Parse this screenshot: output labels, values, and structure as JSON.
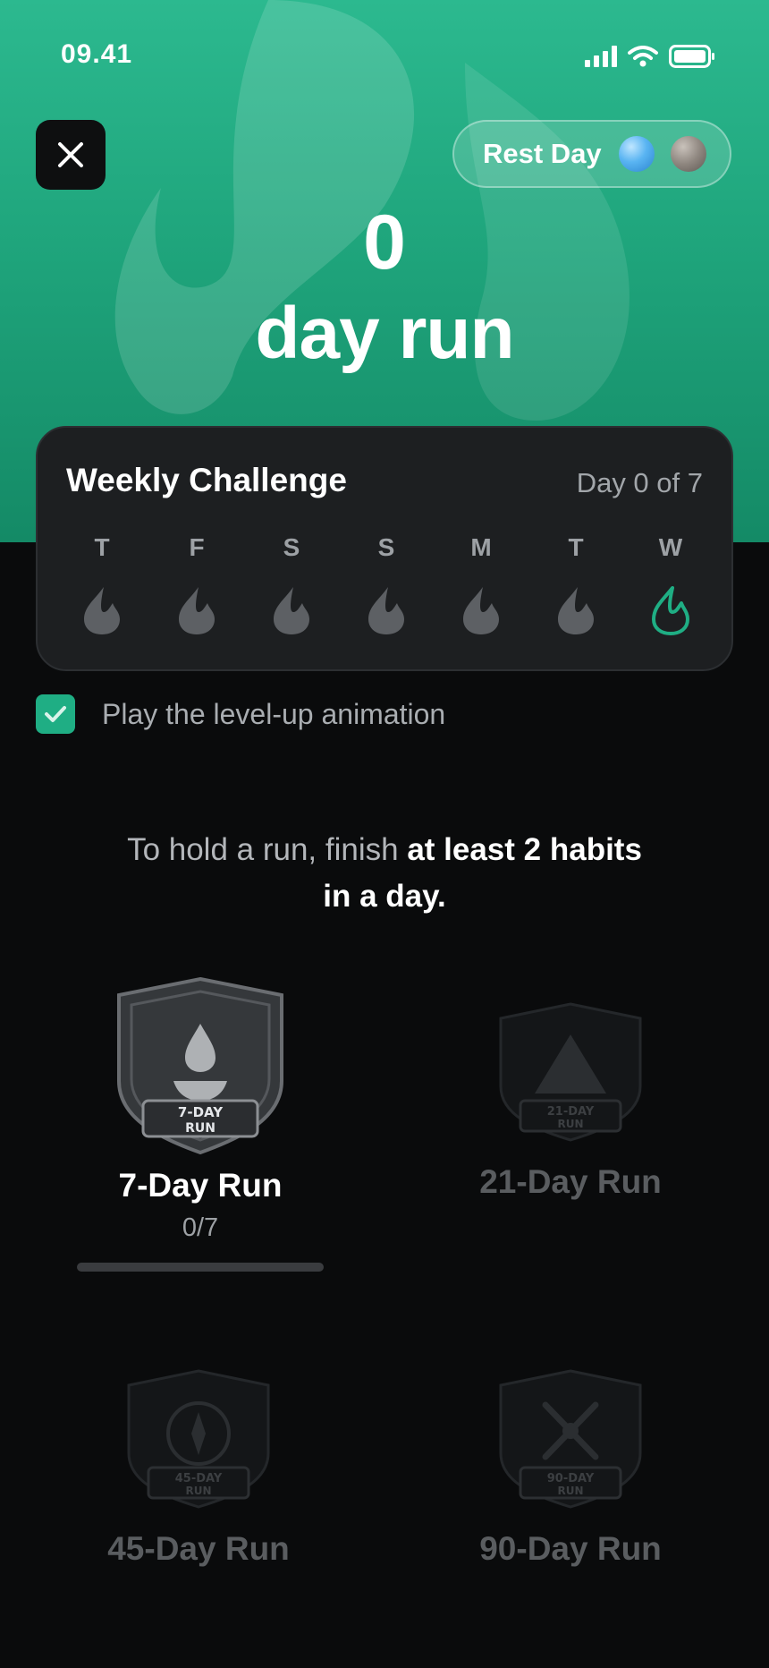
{
  "status_bar": {
    "time": "09.41"
  },
  "header": {
    "rest_day_label": "Rest Day",
    "run_count": "0",
    "run_label": "day run",
    "accent_color": "#1fa57c"
  },
  "weekly_challenge": {
    "title": "Weekly Challenge",
    "progress": "Day 0 of 7",
    "days": [
      {
        "letter": "T",
        "state": "inactive"
      },
      {
        "letter": "F",
        "state": "inactive"
      },
      {
        "letter": "S",
        "state": "inactive"
      },
      {
        "letter": "S",
        "state": "inactive"
      },
      {
        "letter": "M",
        "state": "inactive"
      },
      {
        "letter": "T",
        "state": "inactive"
      },
      {
        "letter": "W",
        "state": "today"
      }
    ]
  },
  "options": {
    "animation_label": "Play the level-up animation",
    "animation_checked": true
  },
  "rule": {
    "prefix": "To hold a run, finish ",
    "emphasis_1": "at least 2 habits",
    "emphasis_2": "in a day."
  },
  "badges": [
    {
      "name": "7-Day Run",
      "shield_text_1": "7-DAY",
      "shield_text_2": "RUN",
      "count": "0/7",
      "progress": 0,
      "locked": false,
      "icon": "drop-icon"
    },
    {
      "name": "21-Day Run",
      "shield_text_1": "21-DAY",
      "shield_text_2": "RUN",
      "locked": true,
      "icon": "mountain-icon"
    },
    {
      "name": "45-Day Run",
      "shield_text_1": "45-DAY",
      "shield_text_2": "RUN",
      "locked": true,
      "icon": "compass-icon"
    },
    {
      "name": "90-Day Run",
      "shield_text_1": "90-DAY",
      "shield_text_2": "RUN",
      "locked": true,
      "icon": "x-icon"
    }
  ]
}
